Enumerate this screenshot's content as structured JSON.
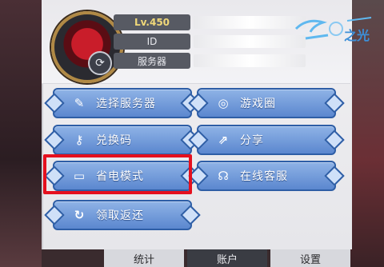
{
  "profile": {
    "level": "Lv.450",
    "id_label": "ID",
    "server_label": "服务器"
  },
  "logo": {
    "text": "之光"
  },
  "buttons": {
    "select_server": "选择服务器",
    "game_circle": "游戏圈",
    "redeem_code": "兑换码",
    "share": "分享",
    "power_saving": "省电模式",
    "online_service": "在线客服",
    "claim_return": "领取返还"
  },
  "tabs": {
    "stats": "统计",
    "account": "账户",
    "settings": "设置"
  },
  "colors": {
    "button_blue": "#6f98d9",
    "highlight_red": "#e5101e",
    "level_gold": "#f0d879"
  }
}
